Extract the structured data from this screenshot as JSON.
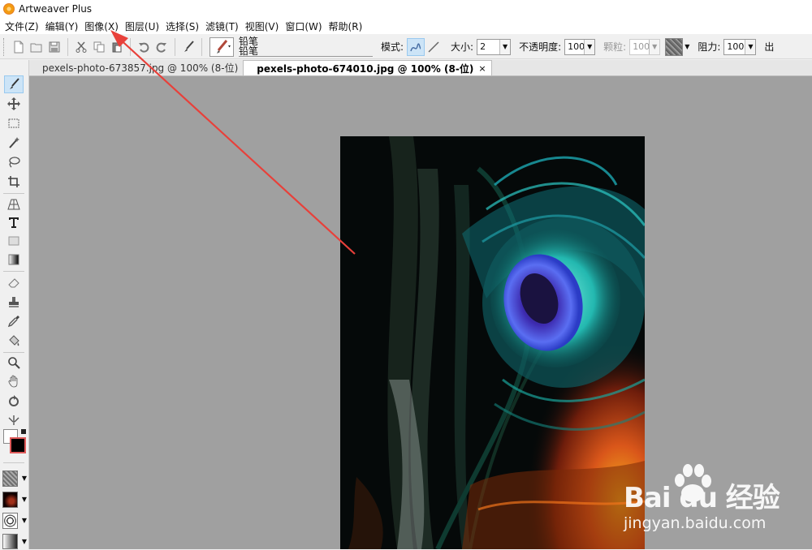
{
  "window": {
    "title": "Artweaver Plus"
  },
  "menu": [
    "文件(Z)",
    "编辑(Y)",
    "图像(X)",
    "图层(U)",
    "选择(S)",
    "滤镜(T)",
    "视图(V)",
    "窗口(W)",
    "帮助(R)"
  ],
  "toolbar": {
    "preset_name": "铅笔",
    "preset_name_2": "铅笔",
    "mode_label": "模式:",
    "size_label": "大小:",
    "size_value": "2",
    "opacity_label": "不透明度:",
    "opacity_value": "100",
    "grain_label": "颗粒:",
    "grain_value": "100",
    "resistance_label": "阻力:",
    "resistance_value": "100",
    "flow_label": "出"
  },
  "tabs": [
    {
      "label": "pexels-photo-673857.jpg @ 100% (8-位)",
      "active": false
    },
    {
      "label": "pexels-photo-674010.jpg @ 100% (8-位)",
      "active": true,
      "close": "×"
    }
  ],
  "watermark": {
    "brand": "Bai du 经验",
    "url": "jingyan.baidu.com"
  },
  "colors": {
    "annotation_arrow": "#e8403a",
    "canvas_bg": "#a0a0a0",
    "foreground": "#000000",
    "background": "#ffffff"
  },
  "icons": [
    "new-icon",
    "open-icon",
    "save-icon",
    "cut-icon",
    "copy-icon",
    "paste-icon",
    "undo-icon",
    "redo-icon",
    "brush-icon"
  ]
}
